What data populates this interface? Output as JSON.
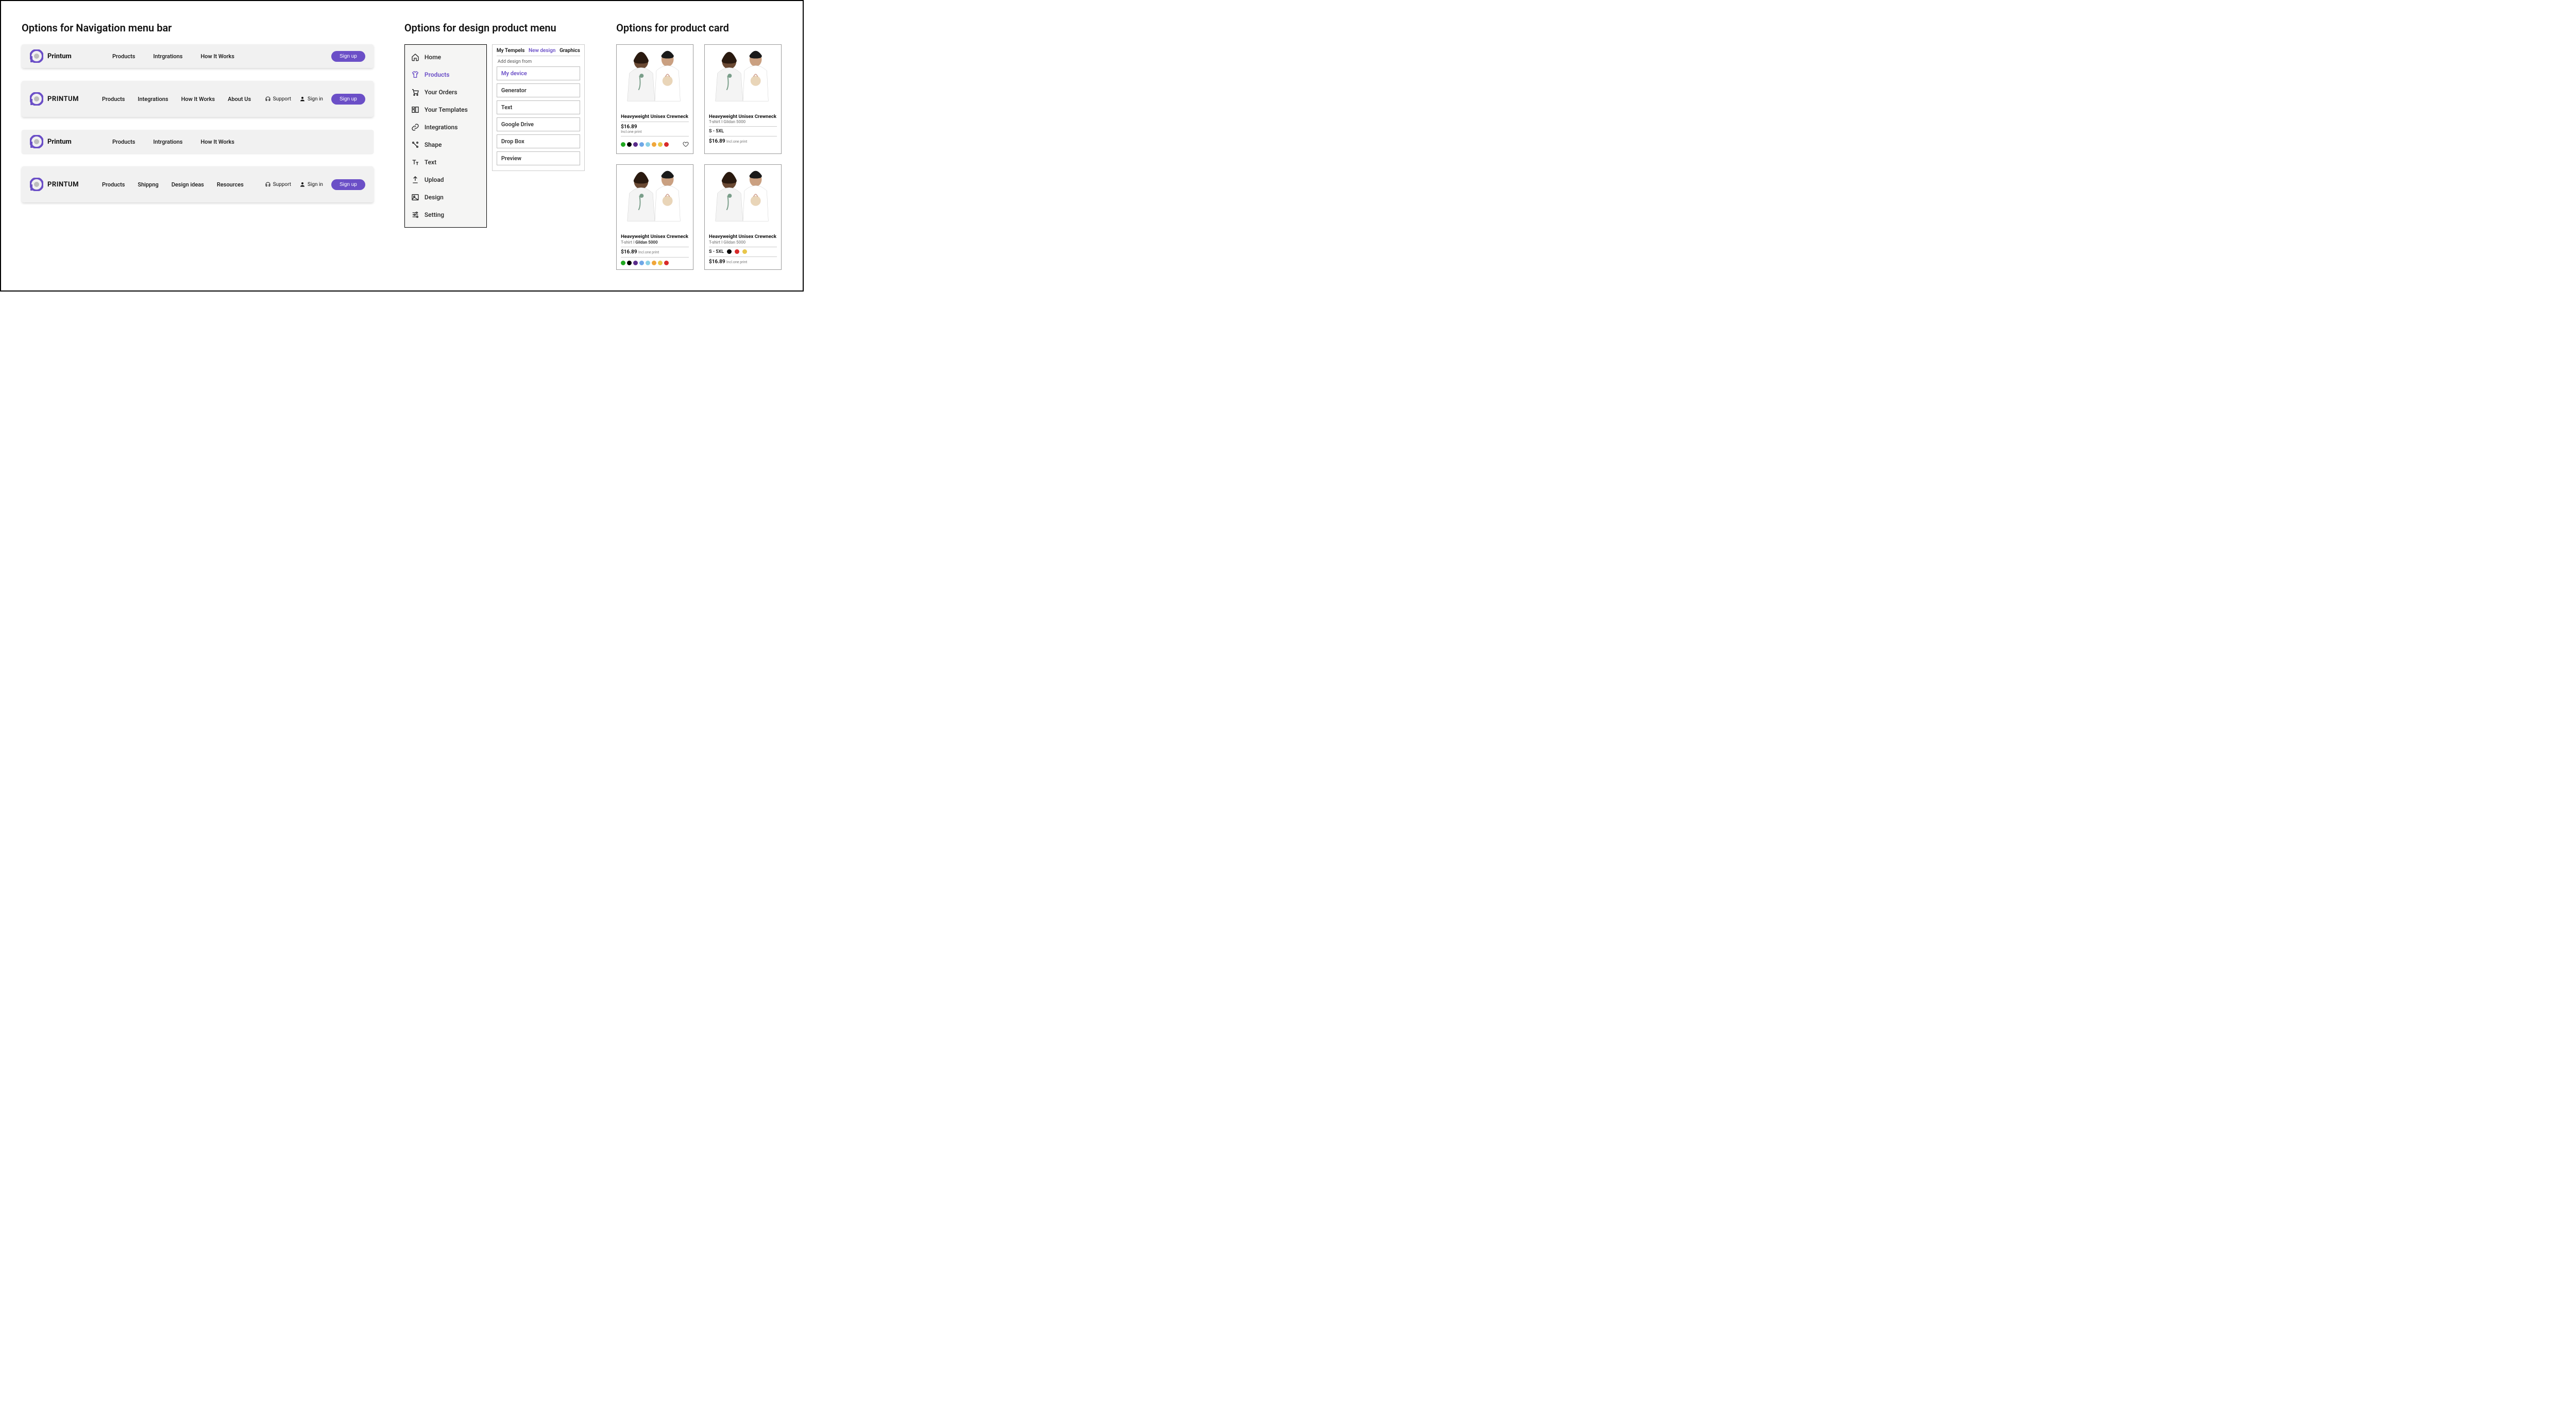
{
  "sections": {
    "nav_title": "Options for Navigation menu bar",
    "design_title": "Options for design product menu",
    "card_title": "Options for product card"
  },
  "brand_mixed": "Printum",
  "brand_upper": "PRINTUM",
  "nav1": {
    "items": [
      "Products",
      "Intrgrations",
      "How It Works"
    ],
    "signup": "Sign up"
  },
  "nav2": {
    "items": [
      "Products",
      "Integrations",
      "How It Works",
      "About Us"
    ],
    "support": "Support",
    "signin": "Sign in",
    "signup": "Sign up"
  },
  "nav3": {
    "items": [
      "Products",
      "Intrgrations",
      "How It Works"
    ]
  },
  "nav4": {
    "items": [
      "Products",
      "Shippng",
      "Design ideas",
      "Resources"
    ],
    "support": "Support",
    "signin": "Sign in",
    "signup": "Sign up"
  },
  "sidebar": {
    "items": [
      "Home",
      "Products",
      "Your Orders",
      "Your Templates",
      "Integrations",
      "Shape",
      "Text",
      "Upload",
      "Design",
      "Setting"
    ],
    "active_index": 1
  },
  "panel": {
    "tabs": [
      "My Tempels",
      "New design",
      "Graphics"
    ],
    "tab_active": 1,
    "label": "Add design from",
    "options": [
      "My device",
      "Generator",
      "Text",
      "Google Drive",
      "Drop Box",
      "Preview"
    ],
    "option_active": 0
  },
  "product": {
    "title": "Heavyweight Unisex Crewneck",
    "subline_prefix": "T-shirt I ",
    "model": "Gildan 5000",
    "price": "$16.89",
    "note": "Incl.one print",
    "sizes": "S  -  5XL",
    "swatches_full": [
      "#1fa81f",
      "#000000",
      "#5a2b8a",
      "#6fa7e6",
      "#8ad0e6",
      "#f0a63a",
      "#e8c64a",
      "#d82a2a"
    ],
    "swatches_three": [
      "#000000",
      "#d82a2a",
      "#e8c64a"
    ]
  }
}
